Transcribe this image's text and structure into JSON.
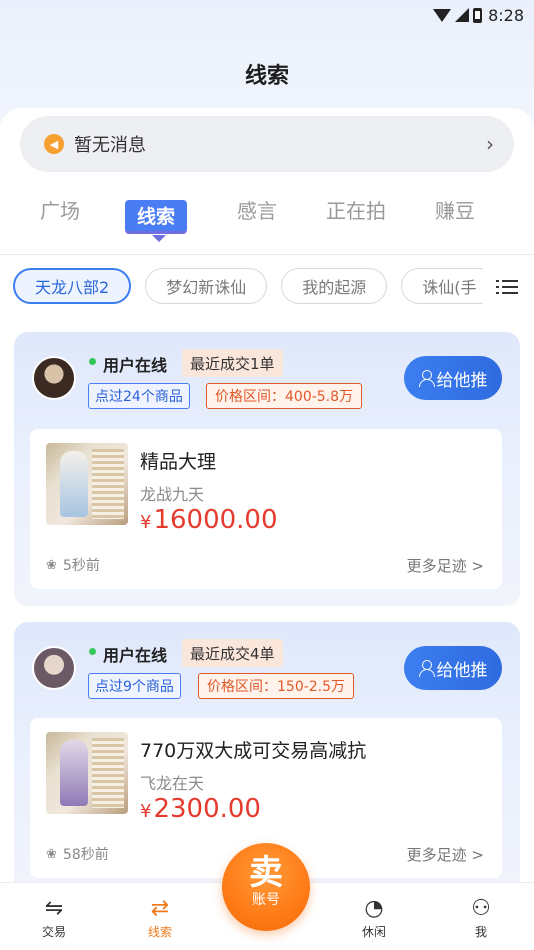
{
  "status_bar": {
    "time": "8:28"
  },
  "page": {
    "title": "线索"
  },
  "notice": {
    "text": "暂无消息"
  },
  "tabs": [
    {
      "label": "广场",
      "active": false
    },
    {
      "label": "线索",
      "active": true
    },
    {
      "label": "感言",
      "active": false
    },
    {
      "label": "正在拍",
      "active": false
    },
    {
      "label": "赚豆",
      "active": false
    }
  ],
  "chips": [
    {
      "label": "天龙八部2",
      "active": true
    },
    {
      "label": "梦幻新诛仙",
      "active": false
    },
    {
      "label": "我的起源",
      "active": false
    },
    {
      "label": "诛仙(手",
      "active": false
    }
  ],
  "cards": [
    {
      "status": "用户在线",
      "recent": "最近成交1单",
      "clicked": "点过24个商品",
      "price_range": "价格区间：400-5.8万",
      "push_label": "给他推",
      "item": {
        "title": "精品大理",
        "server": "龙战九天",
        "currency": "¥",
        "price": "16000.00"
      },
      "time_ago": "5秒前",
      "more": "更多足迹 >"
    },
    {
      "status": "用户在线",
      "recent": "最近成交4单",
      "clicked": "点过9个商品",
      "price_range": "价格区间：150-2.5万",
      "push_label": "给他推",
      "item": {
        "title": "770万双大成可交易高减抗",
        "server": "飞龙在天",
        "currency": "¥",
        "price": "2300.00"
      },
      "time_ago": "58秒前",
      "more": "更多足迹 >"
    }
  ],
  "bottom_nav": {
    "items": [
      {
        "label": "交易",
        "icon": "trade-icon"
      },
      {
        "label": "线索",
        "icon": "clue-icon",
        "active": true
      },
      {
        "label": "休闲",
        "icon": "leisure-icon"
      },
      {
        "label": "我",
        "icon": "profile-icon"
      }
    ],
    "sell": {
      "main": "卖",
      "sub": "账号"
    }
  },
  "colors": {
    "accent_blue": "#3c7ef0",
    "price_red": "#e53b2f",
    "sell_orange": "#ff7b16"
  }
}
